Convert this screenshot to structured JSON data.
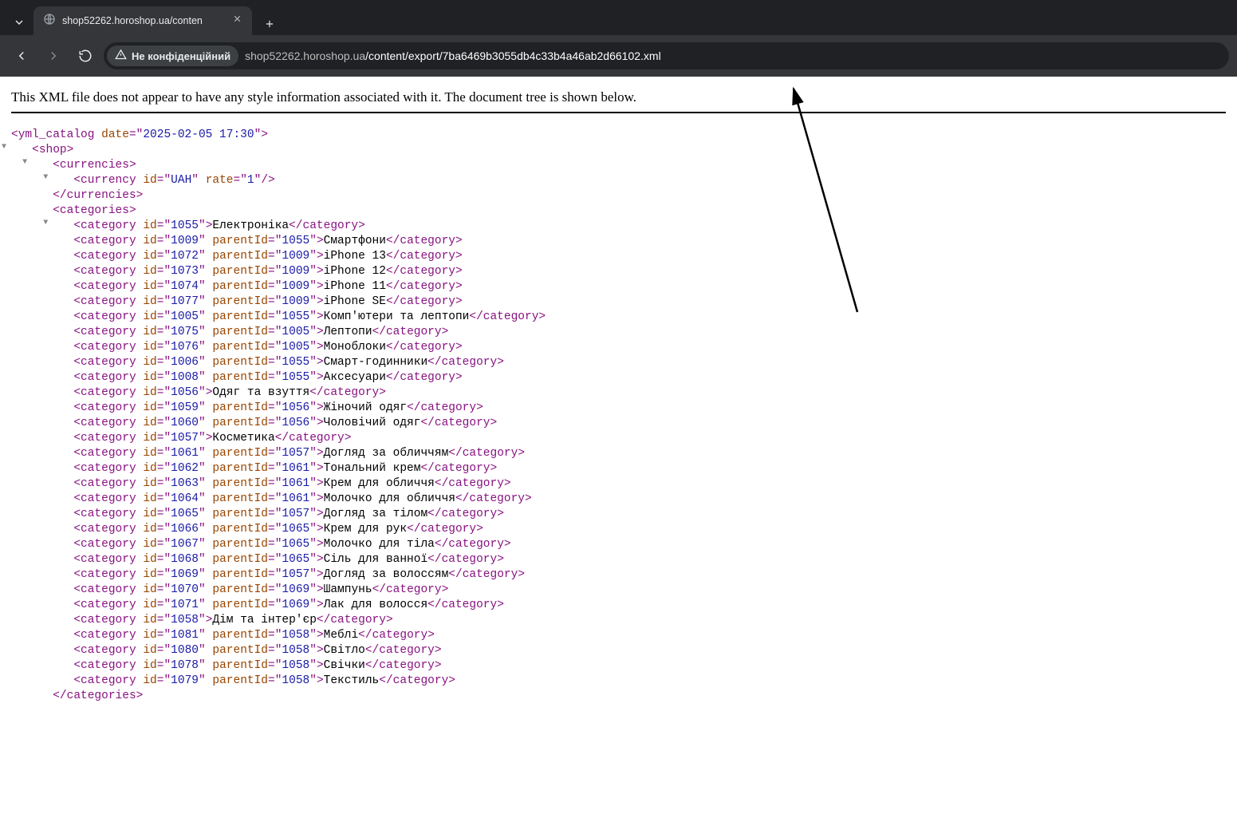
{
  "browser": {
    "tab_title": "shop52262.horoshop.ua/conten",
    "security_label": "Не конфіденційний",
    "url_host": "shop52262.horoshop.ua",
    "url_path": "/content/export/7ba6469b3055db4c33b4a46ab2d66102.xml"
  },
  "xml_banner": "This XML file does not appear to have any style information associated with it. The document tree is shown below.",
  "root": {
    "tag": "yml_catalog",
    "date_attr": "date",
    "date_val": "2025-02-05 17:30"
  },
  "shop_tag": "shop",
  "currencies": {
    "open": "currencies",
    "item_tag": "currency",
    "id_attr": "id",
    "id_val": "UAH",
    "rate_attr": "rate",
    "rate_val": "1",
    "close": "currencies"
  },
  "categories_open": "categories",
  "categories_close": "categories",
  "cat_tag": "category",
  "id_attr": "id",
  "pid_attr": "parentId",
  "categories": [
    {
      "id": "1055",
      "parentId": null,
      "text": "Електроніка"
    },
    {
      "id": "1009",
      "parentId": "1055",
      "text": "Смартфони"
    },
    {
      "id": "1072",
      "parentId": "1009",
      "text": "iPhone 13"
    },
    {
      "id": "1073",
      "parentId": "1009",
      "text": "iPhone 12"
    },
    {
      "id": "1074",
      "parentId": "1009",
      "text": "iPhone 11"
    },
    {
      "id": "1077",
      "parentId": "1009",
      "text": "iPhone SE"
    },
    {
      "id": "1005",
      "parentId": "1055",
      "text": "Комп'ютери та лептопи"
    },
    {
      "id": "1075",
      "parentId": "1005",
      "text": "Лептопи"
    },
    {
      "id": "1076",
      "parentId": "1005",
      "text": "Моноблоки"
    },
    {
      "id": "1006",
      "parentId": "1055",
      "text": "Смарт-годинники"
    },
    {
      "id": "1008",
      "parentId": "1055",
      "text": "Аксесуари"
    },
    {
      "id": "1056",
      "parentId": null,
      "text": "Одяг та взуття"
    },
    {
      "id": "1059",
      "parentId": "1056",
      "text": "Жіночий одяг"
    },
    {
      "id": "1060",
      "parentId": "1056",
      "text": "Чоловічий одяг"
    },
    {
      "id": "1057",
      "parentId": null,
      "text": "Косметика"
    },
    {
      "id": "1061",
      "parentId": "1057",
      "text": "Догляд за обличчям"
    },
    {
      "id": "1062",
      "parentId": "1061",
      "text": "Тональний крем"
    },
    {
      "id": "1063",
      "parentId": "1061",
      "text": "Крем для обличчя"
    },
    {
      "id": "1064",
      "parentId": "1061",
      "text": "Молочко для обличчя"
    },
    {
      "id": "1065",
      "parentId": "1057",
      "text": "Догляд за тілом"
    },
    {
      "id": "1066",
      "parentId": "1065",
      "text": "Крем для рук"
    },
    {
      "id": "1067",
      "parentId": "1065",
      "text": "Молочко для тіла"
    },
    {
      "id": "1068",
      "parentId": "1065",
      "text": "Сіль для ванної"
    },
    {
      "id": "1069",
      "parentId": "1057",
      "text": "Догляд за волоссям"
    },
    {
      "id": "1070",
      "parentId": "1069",
      "text": "Шампунь"
    },
    {
      "id": "1071",
      "parentId": "1069",
      "text": "Лак для волосся"
    },
    {
      "id": "1058",
      "parentId": null,
      "text": "Дім та інтер'єр"
    },
    {
      "id": "1081",
      "parentId": "1058",
      "text": "Меблі"
    },
    {
      "id": "1080",
      "parentId": "1058",
      "text": "Світло"
    },
    {
      "id": "1078",
      "parentId": "1058",
      "text": "Свічки"
    },
    {
      "id": "1079",
      "parentId": "1058",
      "text": "Текстиль"
    }
  ]
}
